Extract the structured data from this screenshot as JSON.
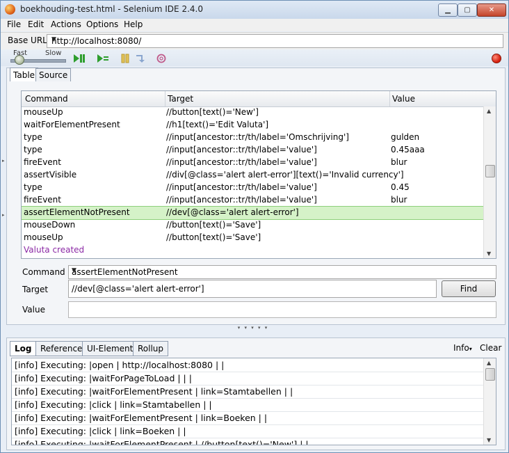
{
  "window": {
    "title": "boekhouding-test.html - Selenium IDE 2.4.0",
    "controls": {
      "minimize": "▁",
      "maximize": "▢",
      "close": "✕"
    }
  },
  "menu": [
    "File",
    "Edit",
    "Actions",
    "Options",
    "Help"
  ],
  "base_url": {
    "label": "Base URL",
    "value": "http://localhost:8080/"
  },
  "toolbar": {
    "speed_fast": "Fast",
    "speed_slow": "Slow",
    "icons": [
      "play-all-icon",
      "play-current-icon",
      "pause-icon",
      "step-icon",
      "rollup-icon",
      "record-icon"
    ]
  },
  "editor_tabs": [
    "Table",
    "Source"
  ],
  "grid": {
    "headers": {
      "command": "Command",
      "target": "Target",
      "value": "Value"
    },
    "rows": [
      {
        "command": "mouseUp",
        "target": "//button[text()='New']",
        "value": ""
      },
      {
        "command": "waitForElementPresent",
        "target": "//h1[text()='Edit Valuta']",
        "value": ""
      },
      {
        "command": "type",
        "target": "//input[ancestor::tr/th/label='Omschrijving']",
        "value": "gulden"
      },
      {
        "command": "type",
        "target": "//input[ancestor::tr/th/label='value']",
        "value": "0.45aaa"
      },
      {
        "command": "fireEvent",
        "target": "//input[ancestor::tr/th/label='value']",
        "value": "blur"
      },
      {
        "command": "assertVisible",
        "target": "//div[@class='alert alert-error'][text()='Invalid currency']",
        "value": ""
      },
      {
        "command": "type",
        "target": "//input[ancestor::tr/th/label='value']",
        "value": "0.45"
      },
      {
        "command": "fireEvent",
        "target": "//input[ancestor::tr/th/label='value']",
        "value": "blur"
      },
      {
        "command": "assertElementNotPresent",
        "target": "//dev[@class='alert alert-error']",
        "value": "",
        "selected": true
      },
      {
        "command": "mouseDown",
        "target": "//button[text()='Save']",
        "value": ""
      },
      {
        "command": "mouseUp",
        "target": "//button[text()='Save']",
        "value": ""
      },
      {
        "command": "Valuta created",
        "target": "",
        "value": "",
        "comment": true
      }
    ]
  },
  "form": {
    "command_label": "Command",
    "command_value": "assertElementNotPresent",
    "target_label": "Target",
    "target_value": "//dev[@class='alert alert-error']",
    "find_label": "Find",
    "value_label": "Value",
    "value_value": ""
  },
  "log_tabs": [
    "Log",
    "Reference",
    "UI-Element",
    "Rollup"
  ],
  "log_controls": {
    "info": "Info",
    "clear": "Clear"
  },
  "log_lines": [
    "[info] Executing: |open | http://localhost:8080 | |",
    "[info] Executing: |waitForPageToLoad | | |",
    "[info] Executing: |waitForElementPresent | link=Stamtabellen | |",
    "[info] Executing: |click | link=Stamtabellen | |",
    "[info] Executing: |waitForElementPresent | link=Boeken | |",
    "[info] Executing: |click | link=Boeken | |",
    "[info] Executing: |waitForElementPresent | //button[text()='New'] | |"
  ]
}
